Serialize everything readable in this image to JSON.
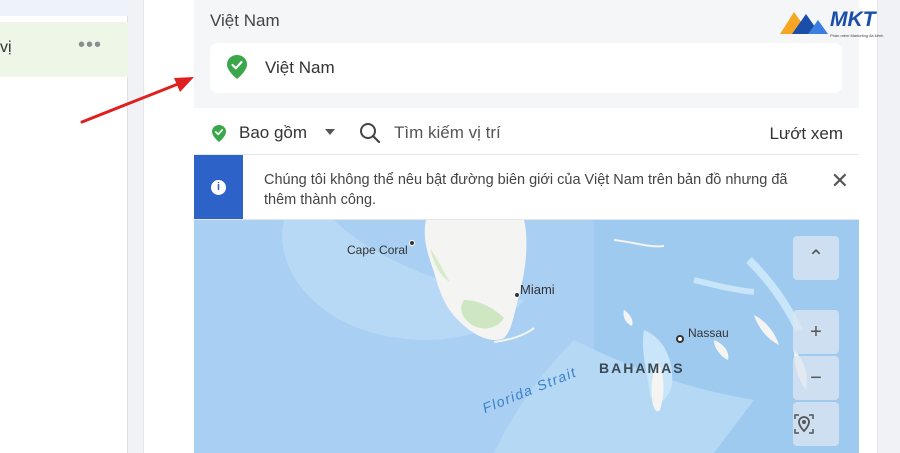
{
  "sidebar": {
    "item_label": "vị",
    "more_label": "•••"
  },
  "location": {
    "section_title": "Việt Nam",
    "selected_chip": "Việt Nam"
  },
  "search_row": {
    "include_label": "Bao gồm",
    "search_placeholder": "Tìm kiếm vị trí",
    "browse_label": "Lướt xem"
  },
  "banner": {
    "info_icon": "i",
    "message": "Chúng tôi không thể nêu bật đường biên giới của Việt Nam trên bản đồ nhưng đã thêm thành công.",
    "close": "✕"
  },
  "map": {
    "labels": {
      "cape_coral": "Cape Coral",
      "miami": "Miami",
      "nassau": "Nassau",
      "bahamas": "BAHAMAS",
      "florida_strait": "Florida Strait"
    },
    "controls": {
      "collapse": "⌃",
      "zoom_in": "+",
      "zoom_out": "−"
    }
  },
  "logo": {
    "brand": "MKT",
    "tagline": "Phần mềm Marketing đa kênh"
  },
  "colors": {
    "accent_green": "#3aa84a",
    "banner_blue": "#2d63c8",
    "annotation_red": "#e02020",
    "map_water": "#9fcaf0",
    "map_land": "#f4f4f2"
  }
}
